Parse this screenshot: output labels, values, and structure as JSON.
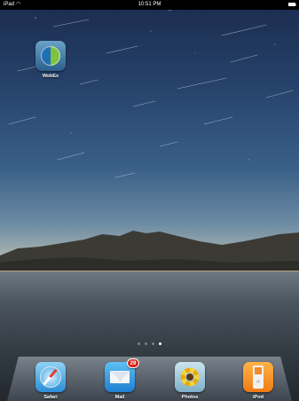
{
  "status_bar": {
    "device": "iPad",
    "wifi_icon": "wifi-icon",
    "time": "10:51 PM",
    "battery_icon": "battery-icon"
  },
  "home_apps": [
    {
      "label": "WebEx",
      "icon": "webex-icon"
    }
  ],
  "page_indicator": {
    "pages": 4,
    "current": 4
  },
  "dock": {
    "apps": [
      {
        "label": "Safari",
        "icon": "safari-compass-icon"
      },
      {
        "label": "Mail",
        "icon": "mail-envelope-icon",
        "badge": "29"
      },
      {
        "label": "Photos",
        "icon": "photos-sunflower-icon"
      },
      {
        "label": "iPod",
        "icon": "ipod-icon"
      }
    ]
  }
}
